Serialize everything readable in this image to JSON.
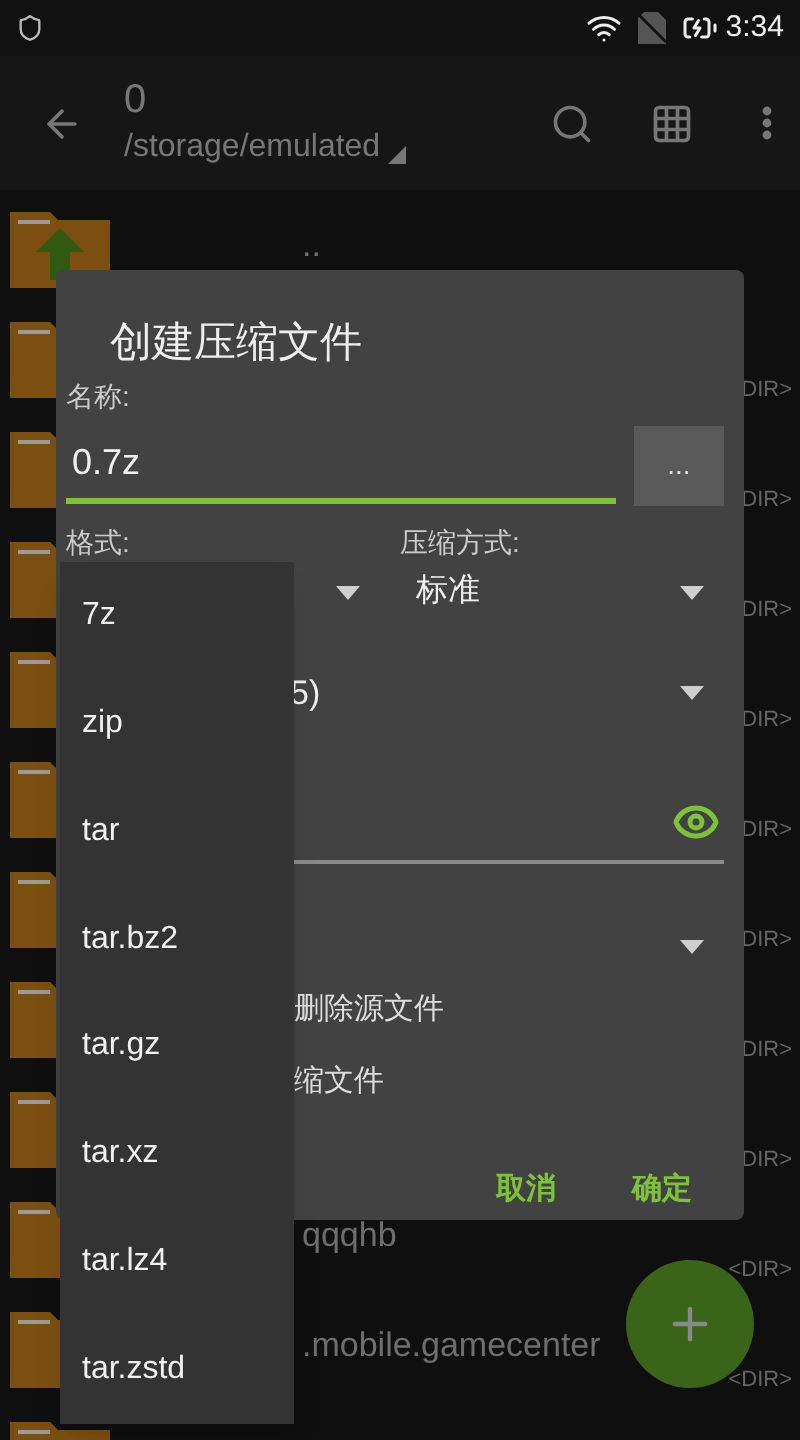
{
  "status_bar": {
    "time": "3:34"
  },
  "toolbar": {
    "title": "0",
    "path": "/storage/emulated"
  },
  "file_list": [
    {
      "name": ".."
    },
    {
      "tag": "DIR>"
    },
    {
      "tag": "DIR>"
    },
    {
      "tag": "DIR>"
    },
    {
      "tag": "DIR>"
    },
    {
      "tag": "DIR>"
    },
    {
      "tag": "DIR>"
    },
    {
      "tag": "DIR>"
    },
    {
      "tag": "DIR>"
    },
    {
      "name": "qqqhb",
      "tag": "<DIR>"
    },
    {
      "name": ".mobile.gamecenter",
      "tag": "<DIR>"
    }
  ],
  "dialog": {
    "title": "创建压缩文件",
    "name_label": "名称:",
    "name_value": "0.7z",
    "browse_button": "...",
    "format_label": "格式:",
    "method_label": "压缩方式:",
    "method_value": "标准",
    "level_value": "5)",
    "delete_source": "删除源文件",
    "last_option": "缩文件",
    "buttons": [
      "取消",
      "确定"
    ]
  },
  "format_menu": [
    {
      "label": "7z",
      "selected": false
    },
    {
      "label": "zip",
      "selected": false
    },
    {
      "label": "tar",
      "selected": false
    },
    {
      "label": "tar.bz2",
      "selected": false
    },
    {
      "label": "tar.gz",
      "selected": false
    },
    {
      "label": "tar.xz",
      "selected": false
    },
    {
      "label": "tar.lz4",
      "selected": false
    },
    {
      "label": "tar.zstd",
      "selected": false
    }
  ]
}
